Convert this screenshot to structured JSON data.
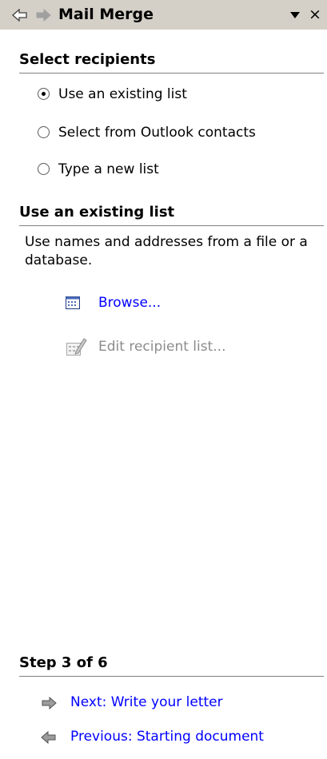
{
  "window": {
    "title": "Mail Merge",
    "close_glyph": "×"
  },
  "select_recipients": {
    "heading": "Select recipients",
    "options": [
      {
        "label": "Use an existing list",
        "selected": true
      },
      {
        "label": "Select from Outlook contacts",
        "selected": false
      },
      {
        "label": "Type a new list",
        "selected": false
      }
    ]
  },
  "existing_list": {
    "heading": "Use an existing list",
    "description": "Use names and addresses from a file or a database.",
    "browse_label": "Browse...",
    "edit_label": "Edit recipient list..."
  },
  "step": {
    "heading": "Step 3 of 6",
    "next_label": "Next: Write your letter",
    "previous_label": "Previous: Starting document"
  },
  "colors": {
    "titlebar_bg": "#d4d0c8",
    "link": "#0000ff",
    "disabled": "#8c8c8c"
  },
  "icons": {
    "back": "back-arrow-icon",
    "forward": "forward-arrow-icon",
    "menu": "dropdown-arrow-icon",
    "close": "close-icon",
    "browse": "address-book-icon",
    "edit": "edit-list-icon",
    "next": "next-arrow-icon",
    "previous": "previous-arrow-icon"
  }
}
